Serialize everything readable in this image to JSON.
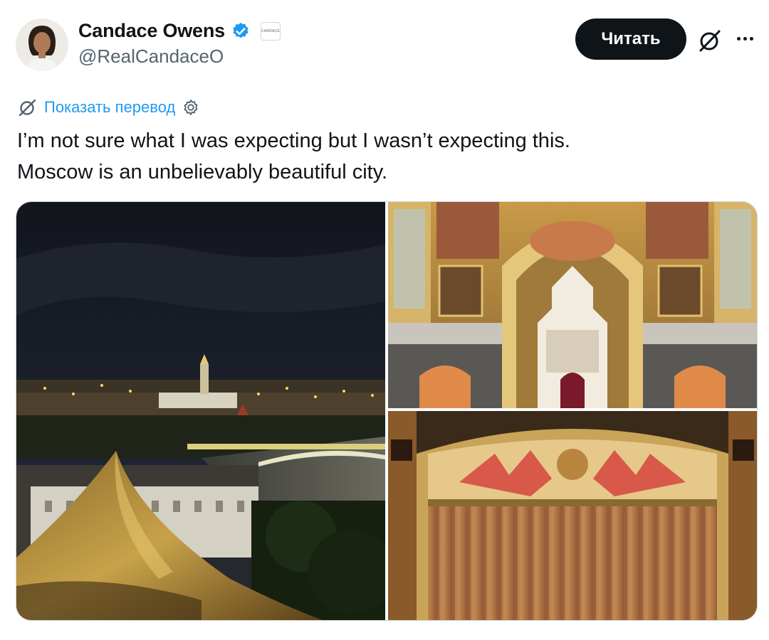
{
  "author": {
    "display_name": "Candace Owens",
    "handle": "@RealCandaceO",
    "verified_icon": "verified-badge-icon",
    "affiliation_badge_text": "CANDACE"
  },
  "actions": {
    "follow_label": "Читать",
    "grok_icon": "grok-icon",
    "more_icon": "more-options-icon"
  },
  "translate": {
    "label": "Показать перевод",
    "globe_icon": "grok-icon",
    "settings_icon": "gear-icon"
  },
  "tweet": {
    "lines": [
      "I’m not sure what I was expecting but I wasn’t expecting this.",
      "Moscow is an unbelievably beautiful city."
    ]
  },
  "media": {
    "photos": [
      "moscow-night-skyline",
      "cathedral-interior",
      "theatre-curtain"
    ]
  },
  "colors": {
    "accent": "#1d9bf0",
    "text": "#0f1419",
    "secondary_text": "#536471",
    "button_bg": "#0f1419"
  }
}
